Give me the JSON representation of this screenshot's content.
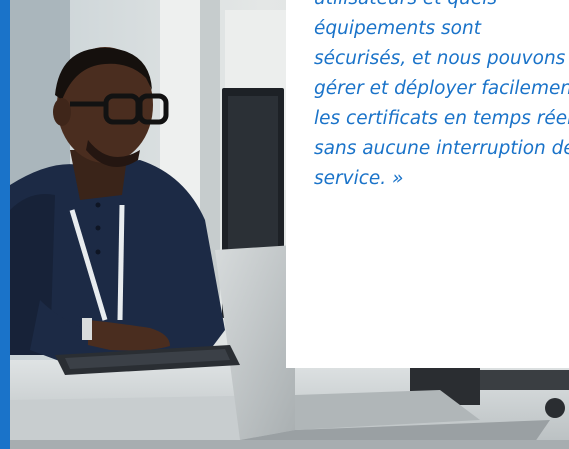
{
  "quote": {
    "lines": [
      "utilisateurs et quels",
      "équipements sont",
      "sécurisés, et nous pouvons",
      "gérer et déployer facilement",
      "les certificats en temps réel",
      "sans aucune interruption de",
      "service. »"
    ]
  },
  "colors": {
    "accent": "#1a73c9",
    "card_background": "#ffffff"
  },
  "photo": {
    "subject": "man-wearing-glasses-working-at-computer-icon"
  }
}
